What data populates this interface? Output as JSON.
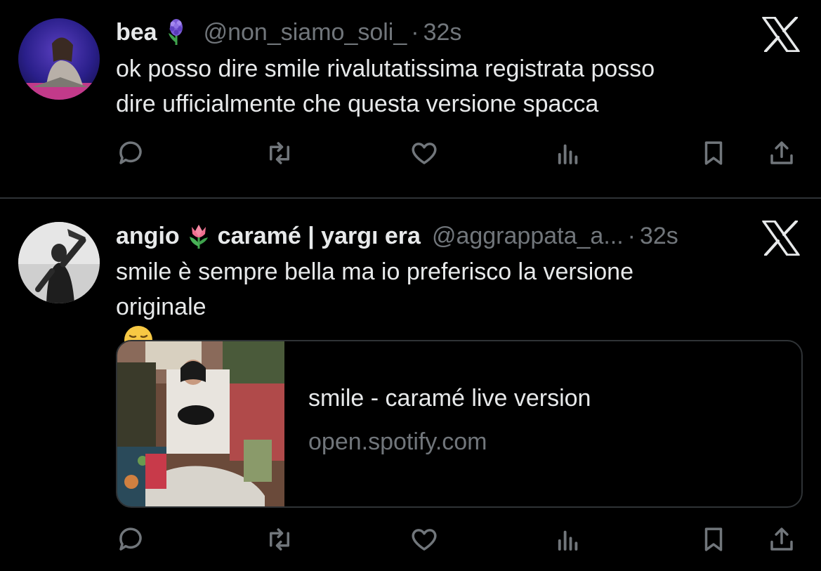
{
  "tweets": [
    {
      "name": "bea",
      "name_suffix": "",
      "handle": "@non_siamo_soli_",
      "time": "32s",
      "text_lines": [
        "ok posso dire smile rivalutatissima registrata posso",
        "dire ufficialmente che questa versione spacca"
      ],
      "emoji": "hyacinth-icon"
    },
    {
      "name": "angio",
      "name_suffix": "caramé | yargı era",
      "handle": "@aggrappata_a...",
      "time": "32s",
      "text_lines": [
        "smile è sempre bella ma io preferisco la versione",
        "originale"
      ],
      "emoji": "tulip-icon",
      "text_emoji": "pensive-face-icon",
      "card": {
        "title": "smile - caramé live version",
        "domain": "open.spotify.com"
      }
    }
  ],
  "separator": "·",
  "icons": [
    "reply-icon",
    "retweet-icon",
    "like-icon",
    "views-icon",
    "bookmark-icon",
    "share-icon",
    "x-logo-icon"
  ],
  "colors": {
    "background": "#000000",
    "text": "#e7e9ea",
    "muted": "#71767b",
    "border": "#2f3336"
  }
}
